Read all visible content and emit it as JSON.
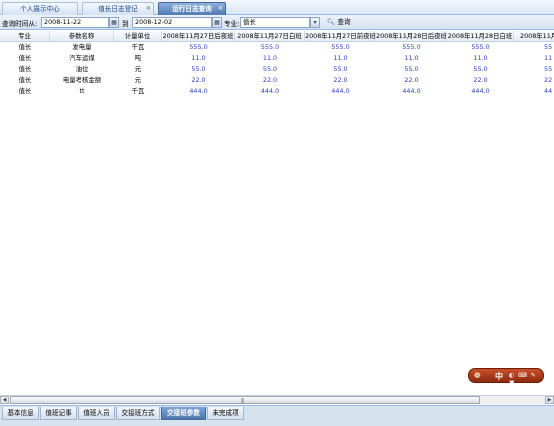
{
  "top_tabs": [
    {
      "label": "个人展示中心",
      "closable": false,
      "active": false
    },
    {
      "label": "值长日志登记",
      "closable": true,
      "active": false
    },
    {
      "label": "运行日志查询",
      "closable": true,
      "active": true
    }
  ],
  "filter": {
    "start_label": "查询时间从:",
    "start_value": "2008-11-22",
    "to_label": "到",
    "end_value": "2008-12-02",
    "major_label": "专业:",
    "major_value": "值长",
    "query_button": "查询"
  },
  "grid": {
    "fixed_headers": [
      "专业",
      "参数名称",
      "计量单位"
    ],
    "shift_headers": [
      "2008年11月27日后夜班",
      "2008年11月27日白班",
      "2008年11月27日前夜班",
      "2008年11月28日后夜班",
      "2008年11月28日白班",
      "2008年11月"
    ],
    "rows": [
      {
        "major": "值长",
        "param": "发电量",
        "unit": "千瓦",
        "values": [
          "555.0",
          "555.0",
          "555.0",
          "555.0",
          "555.0",
          "55"
        ]
      },
      {
        "major": "值长",
        "param": "汽车运煤",
        "unit": "吨",
        "values": [
          "11.0",
          "11.0",
          "11.0",
          "11.0",
          "11.0",
          "11"
        ]
      },
      {
        "major": "值长",
        "param": "油位",
        "unit": "元",
        "values": [
          "55.0",
          "55.0",
          "55.0",
          "55.0",
          "55.0",
          "55"
        ]
      },
      {
        "major": "值长",
        "param": "电量考核金额",
        "unit": "元",
        "values": [
          "22.0",
          "22.0",
          "22.0",
          "22.0",
          "22.0",
          "22"
        ]
      },
      {
        "major": "值长",
        "param": "tt",
        "unit": "千瓦",
        "values": [
          "444.0",
          "444.0",
          "444.0",
          "444.0",
          "444.0",
          "44"
        ]
      }
    ]
  },
  "ime_badge": {
    "icon": "ime-icon",
    "text": "中",
    "extra": "◐ ⌨ ✎ ▣"
  },
  "bottom_tabs": [
    {
      "label": "基本信息",
      "active": false
    },
    {
      "label": "值班记事",
      "active": false
    },
    {
      "label": "值班人员",
      "active": false
    },
    {
      "label": "交接班方式",
      "active": false
    },
    {
      "label": "交接班参数",
      "active": true
    },
    {
      "label": "未完成项",
      "active": false
    }
  ],
  "colors": {
    "accent": "#4f7bb3",
    "value_text": "#2a3fbf",
    "header_border": "#99bbe8"
  }
}
